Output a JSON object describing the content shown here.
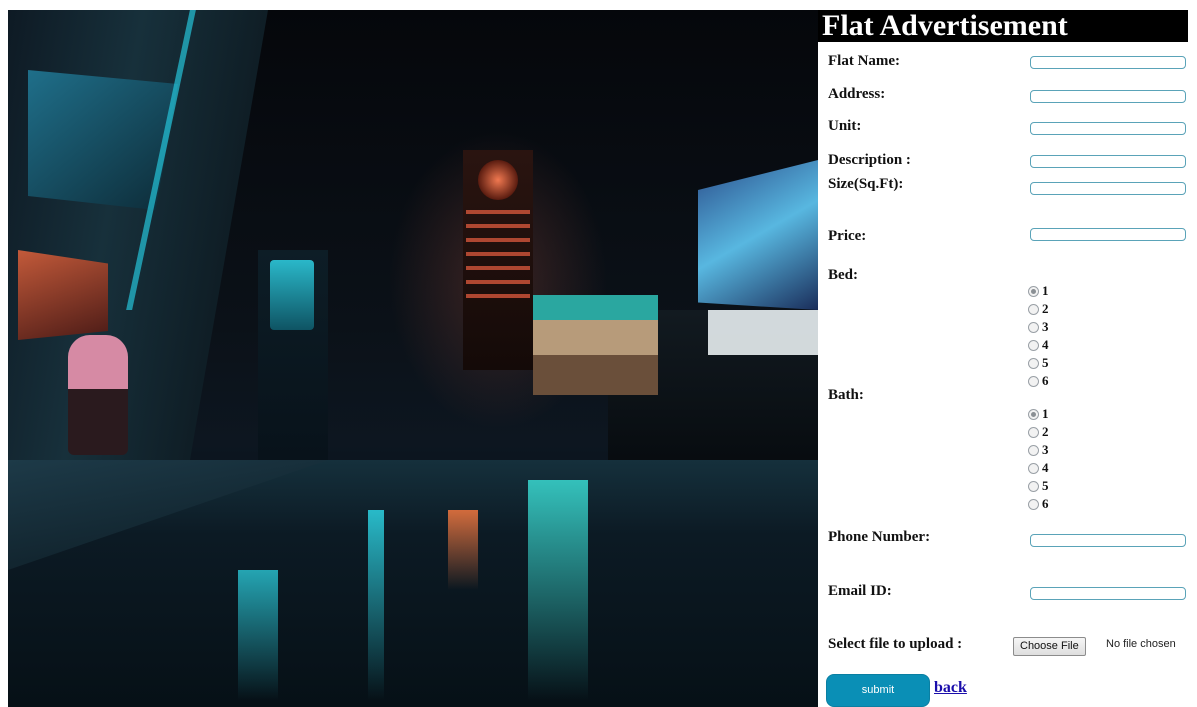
{
  "header": {
    "title": "Flat Advertisement"
  },
  "form": {
    "flat_name_label": "Flat Name:",
    "address_label": "Address:",
    "unit_label": "Unit:",
    "description_label": "Description :",
    "size_label": "Size(Sq.Ft):",
    "price_label": "Price:",
    "bed_label": "Bed:",
    "bath_label": "Bath:",
    "phone_label": "Phone Number:",
    "email_label": "Email ID:",
    "file_label": "Select file to upload :",
    "file_button": "Choose File",
    "file_status": "No file chosen",
    "submit_label": "submit",
    "back_label": "back",
    "bed_options": [
      "1",
      "2",
      "3",
      "4",
      "5",
      "6"
    ],
    "bath_options": [
      "1",
      "2",
      "3",
      "4",
      "5",
      "6"
    ],
    "bed_selected": "1",
    "bath_selected": "1",
    "fields": {
      "flat_name": "",
      "address": "",
      "unit": "",
      "description": "",
      "size": "",
      "price": "",
      "phone": "",
      "email": ""
    }
  },
  "colors": {
    "accent": "#0a8fb6",
    "title_bg": "#000000",
    "link": "#1a0dab",
    "input_border": "#5aa3b8"
  },
  "image": {
    "icon": "city-night-photo"
  }
}
